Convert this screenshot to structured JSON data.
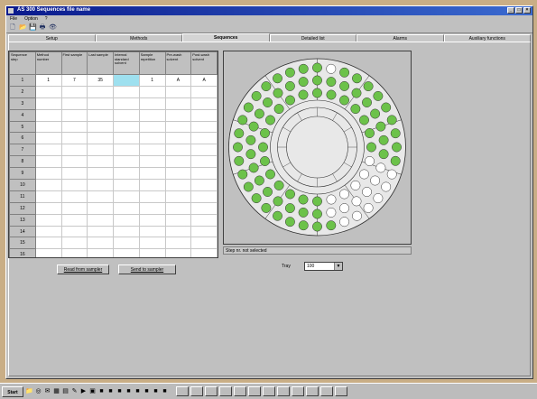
{
  "window": {
    "title": "AS 300 Sequences file name"
  },
  "menu": [
    {
      "label": "File"
    },
    {
      "label": "Option"
    },
    {
      "label": "?"
    }
  ],
  "toolbar": [
    {
      "icon": "new-file-icon",
      "glyph": "🗋"
    },
    {
      "icon": "open-folder-icon",
      "glyph": "📂"
    },
    {
      "icon": "save-icon",
      "glyph": "💾"
    },
    {
      "icon": "print-icon",
      "glyph": "🖶"
    },
    {
      "icon": "binoculars-icon",
      "glyph": "👁"
    }
  ],
  "tabs": [
    {
      "label": "Setup",
      "active": false
    },
    {
      "label": "Methods",
      "active": false
    },
    {
      "label": "Sequences",
      "active": true
    },
    {
      "label": "Detailed list",
      "active": false
    },
    {
      "label": "Alarms",
      "active": false
    },
    {
      "label": "Auxiliary functions",
      "active": false
    }
  ],
  "table": {
    "columns": [
      "Sequence step",
      "Method number",
      "First sample",
      "Last sample",
      "Internal standard solvent",
      "Sample repetition",
      "Pre-wash solvent",
      "Post-wash solvent"
    ],
    "rows": [
      [
        "1",
        "1",
        "7",
        "35",
        "",
        "1",
        "A",
        "A"
      ],
      [
        "2",
        "",
        "",
        "",
        "",
        "",
        "",
        ""
      ],
      [
        "3",
        "",
        "",
        "",
        "",
        "",
        "",
        ""
      ],
      [
        "4",
        "",
        "",
        "",
        "",
        "",
        "",
        ""
      ],
      [
        "5",
        "",
        "",
        "",
        "",
        "",
        "",
        ""
      ],
      [
        "6",
        "",
        "",
        "",
        "",
        "",
        "",
        ""
      ],
      [
        "7",
        "",
        "",
        "",
        "",
        "",
        "",
        ""
      ],
      [
        "8",
        "",
        "",
        "",
        "",
        "",
        "",
        ""
      ],
      [
        "9",
        "",
        "",
        "",
        "",
        "",
        "",
        ""
      ],
      [
        "10",
        "",
        "",
        "",
        "",
        "",
        "",
        ""
      ],
      [
        "11",
        "",
        "",
        "",
        "",
        "",
        "",
        ""
      ],
      [
        "12",
        "",
        "",
        "",
        "",
        "",
        "",
        ""
      ],
      [
        "13",
        "",
        "",
        "",
        "",
        "",
        "",
        ""
      ],
      [
        "14",
        "",
        "",
        "",
        "",
        "",
        "",
        ""
      ],
      [
        "15",
        "",
        "",
        "",
        "",
        "",
        "",
        ""
      ],
      [
        "16",
        "",
        "",
        "",
        "",
        "",
        "",
        ""
      ]
    ],
    "selected_row": 0,
    "selected_col": 4
  },
  "buttons": {
    "read_label": "Read from sampler",
    "send_label": "Send to sampler"
  },
  "tray": {
    "status_text": "Step nr. not selected",
    "label": "Tray",
    "selected": "100",
    "colors": {
      "filled": "#6cc24a",
      "empty": "#ffffff",
      "ring_bg": "#e8e8e8",
      "outline": "#303030"
    }
  },
  "taskbar": {
    "start_label": "Start",
    "icons": [
      "folder-icon",
      "browser-icon",
      "mail-icon",
      "calc-icon",
      "doc-icon",
      "paint-icon",
      "media-icon",
      "shell-icon",
      "app-icon",
      "app-icon",
      "app-icon",
      "app-icon",
      "app-icon",
      "app-icon",
      "app-icon",
      "app-icon"
    ],
    "items": [
      "",
      "",
      "",
      "",
      "",
      "",
      "",
      "",
      "",
      "",
      "",
      ""
    ]
  }
}
